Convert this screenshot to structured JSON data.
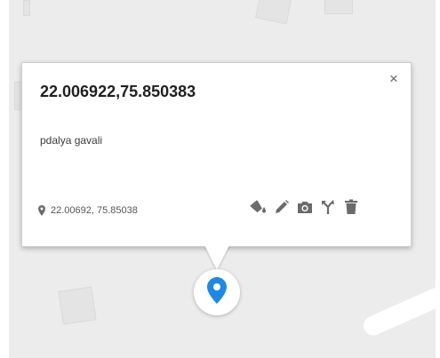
{
  "popup": {
    "title": "22.006922,75.850383",
    "close_glyph": "×",
    "description": "pdalya gavali",
    "coords_text": "22.00692, 75.85038"
  },
  "icons": {
    "location": "location-pin-icon",
    "style": "paint-bucket-icon",
    "edit": "pencil-icon",
    "photo": "camera-icon",
    "route": "directions-fork-icon",
    "delete": "trash-icon",
    "marker": "map-marker-icon"
  },
  "colors": {
    "marker": "#1e88e5",
    "icon": "#6b6b6b",
    "map_background": "#ececec",
    "title_text": "#212121"
  }
}
